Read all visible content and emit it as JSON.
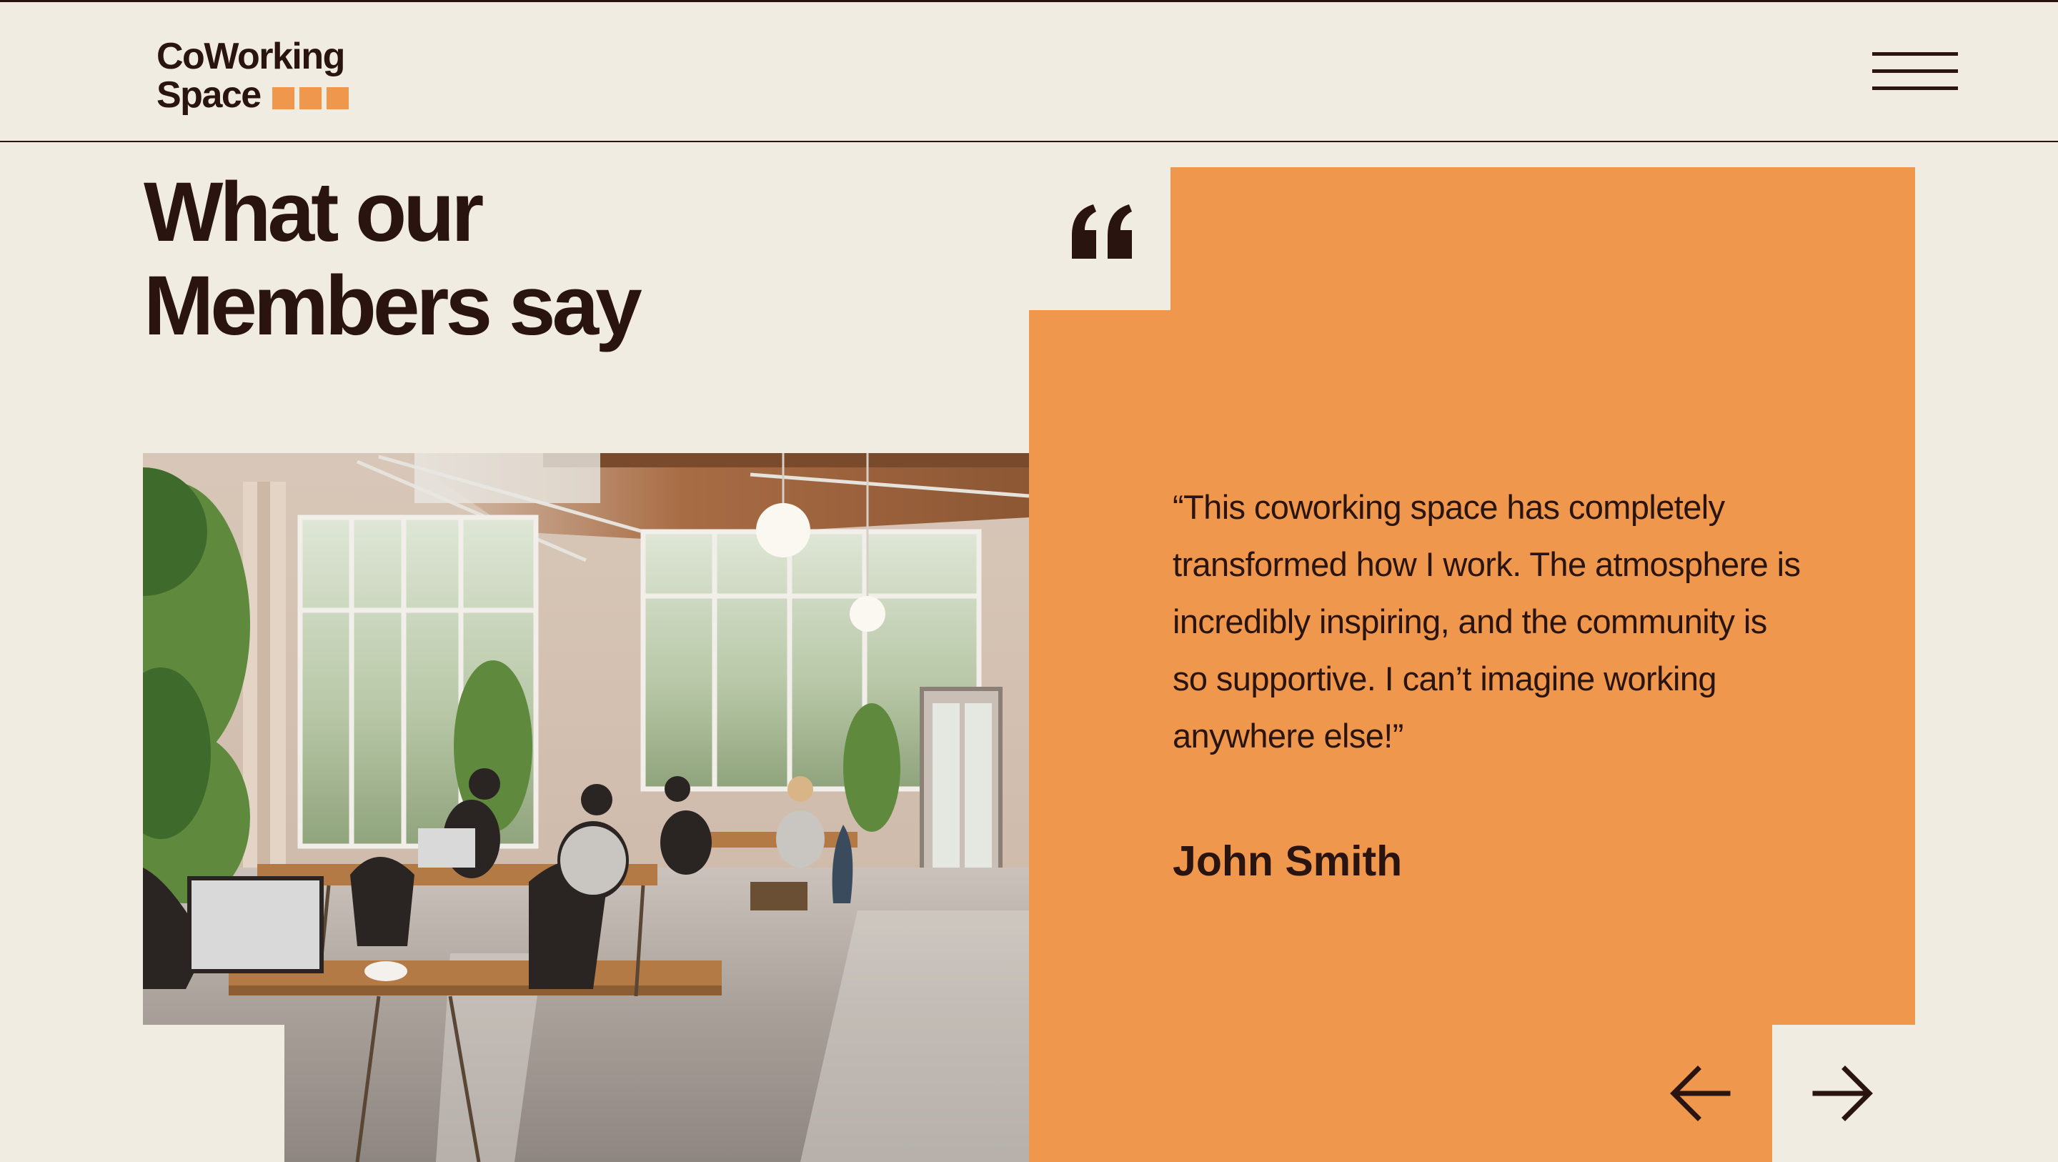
{
  "brand": {
    "line1": "CoWorking",
    "line2": "Space",
    "accent_color": "#ef974d",
    "text_color": "#2a1410",
    "background_color": "#f1ece2"
  },
  "header": {
    "menu_icon": "hamburger-menu-icon"
  },
  "section": {
    "heading_line1": "What our",
    "heading_line2": "Members say"
  },
  "photo": {
    "subject": "coworking-office-interior-photo"
  },
  "testimonial": {
    "quote_icon": "opening-quote-icon",
    "text": "“This coworking space has completely transformed how I work. The atmosphere is incredibly inspiring, and the community is so supportive. I can’t imagine working anywhere else!”",
    "author": "John Smith"
  },
  "controls": {
    "prev_icon": "arrow-left-icon",
    "next_icon": "arrow-right-icon"
  }
}
